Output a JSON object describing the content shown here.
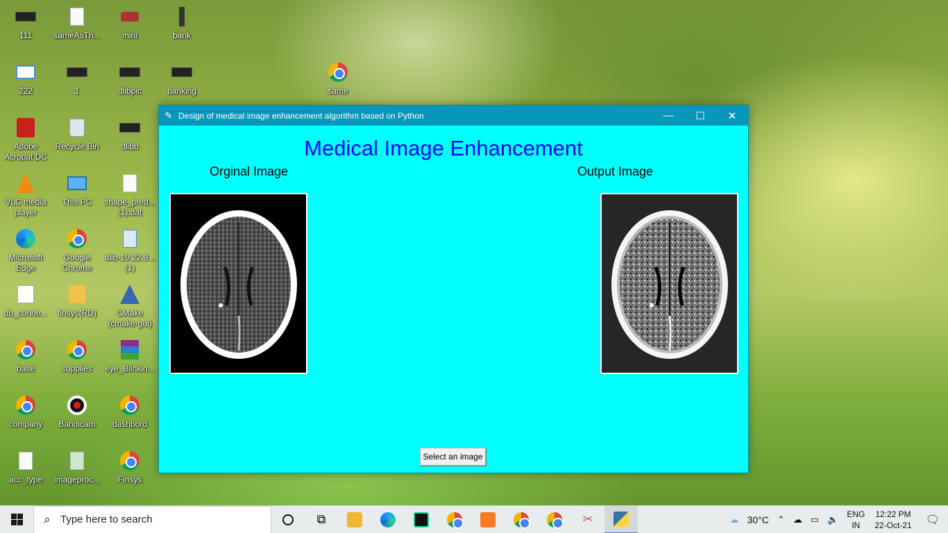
{
  "desktop": {
    "icons": [
      {
        "label": "111",
        "icon": "dark-icon"
      },
      {
        "label": "sameAsTh...",
        "icon": "file-icon"
      },
      {
        "label": "mini",
        "icon": "car-icon"
      },
      {
        "label": "bank",
        "icon": "dark-icon"
      },
      {
        "label": "222",
        "icon": "window-icon"
      },
      {
        "label": "1",
        "icon": "dark-icon"
      },
      {
        "label": "dlibpic",
        "icon": "dark-icon"
      },
      {
        "label": "banking",
        "icon": "dark-icon"
      },
      {
        "label": "same",
        "icon": "chrome-icon"
      },
      {
        "label": "Adobe Acrobat DC",
        "icon": "acrobat-icon"
      },
      {
        "label": "Recycle Bin",
        "icon": "recycle-bin-icon"
      },
      {
        "label": "dlibb",
        "icon": "dark-icon"
      },
      {
        "label": "VLC media player",
        "icon": "vlc-icon"
      },
      {
        "label": "This PC",
        "icon": "pc-icon"
      },
      {
        "label": "shape_pred... (1).dat",
        "icon": "file-icon"
      },
      {
        "label": "Microsoft Edge",
        "icon": "edge-icon"
      },
      {
        "label": "Google Chrome",
        "icon": "chrome-icon"
      },
      {
        "label": "dlib-19.22.9... (1)",
        "icon": "file-icon"
      },
      {
        "label": "db_conne...",
        "icon": "folder-icon"
      },
      {
        "label": "finsys(RD)",
        "icon": "folder-icon"
      },
      {
        "label": "CMake (cmake-gui)",
        "icon": "cmake-icon"
      },
      {
        "label": "base",
        "icon": "chrome-icon"
      },
      {
        "label": "supplies",
        "icon": "chrome-icon"
      },
      {
        "label": "eye_Blinkin...",
        "icon": "winrar-icon"
      },
      {
        "label": "company",
        "icon": "chrome-icon"
      },
      {
        "label": "Bandicam",
        "icon": "bandicam-icon"
      },
      {
        "label": "dashbord",
        "icon": "chrome-icon"
      },
      {
        "label": "acc_type",
        "icon": "file-icon"
      },
      {
        "label": "imageproc...",
        "icon": "file-icon"
      },
      {
        "label": "Finsys",
        "icon": "chrome-icon"
      }
    ]
  },
  "window": {
    "title": "Design of medical image enhancement algorithm based on Python",
    "minimize": "—",
    "maximize": "☐",
    "close": "✕",
    "heading": "Medical Image Enhancement",
    "left_label": "Orginal Image",
    "right_label": "Output Image",
    "button": "Select an image",
    "background_color": "#00ffff",
    "heading_color": "#0000ff"
  },
  "taskbar": {
    "search_placeholder": "Type here to search",
    "weather": "30°C",
    "lang_line1": "ENG",
    "lang_line2": "IN",
    "time": "12:22 PM",
    "date": "22-Oct-21"
  }
}
